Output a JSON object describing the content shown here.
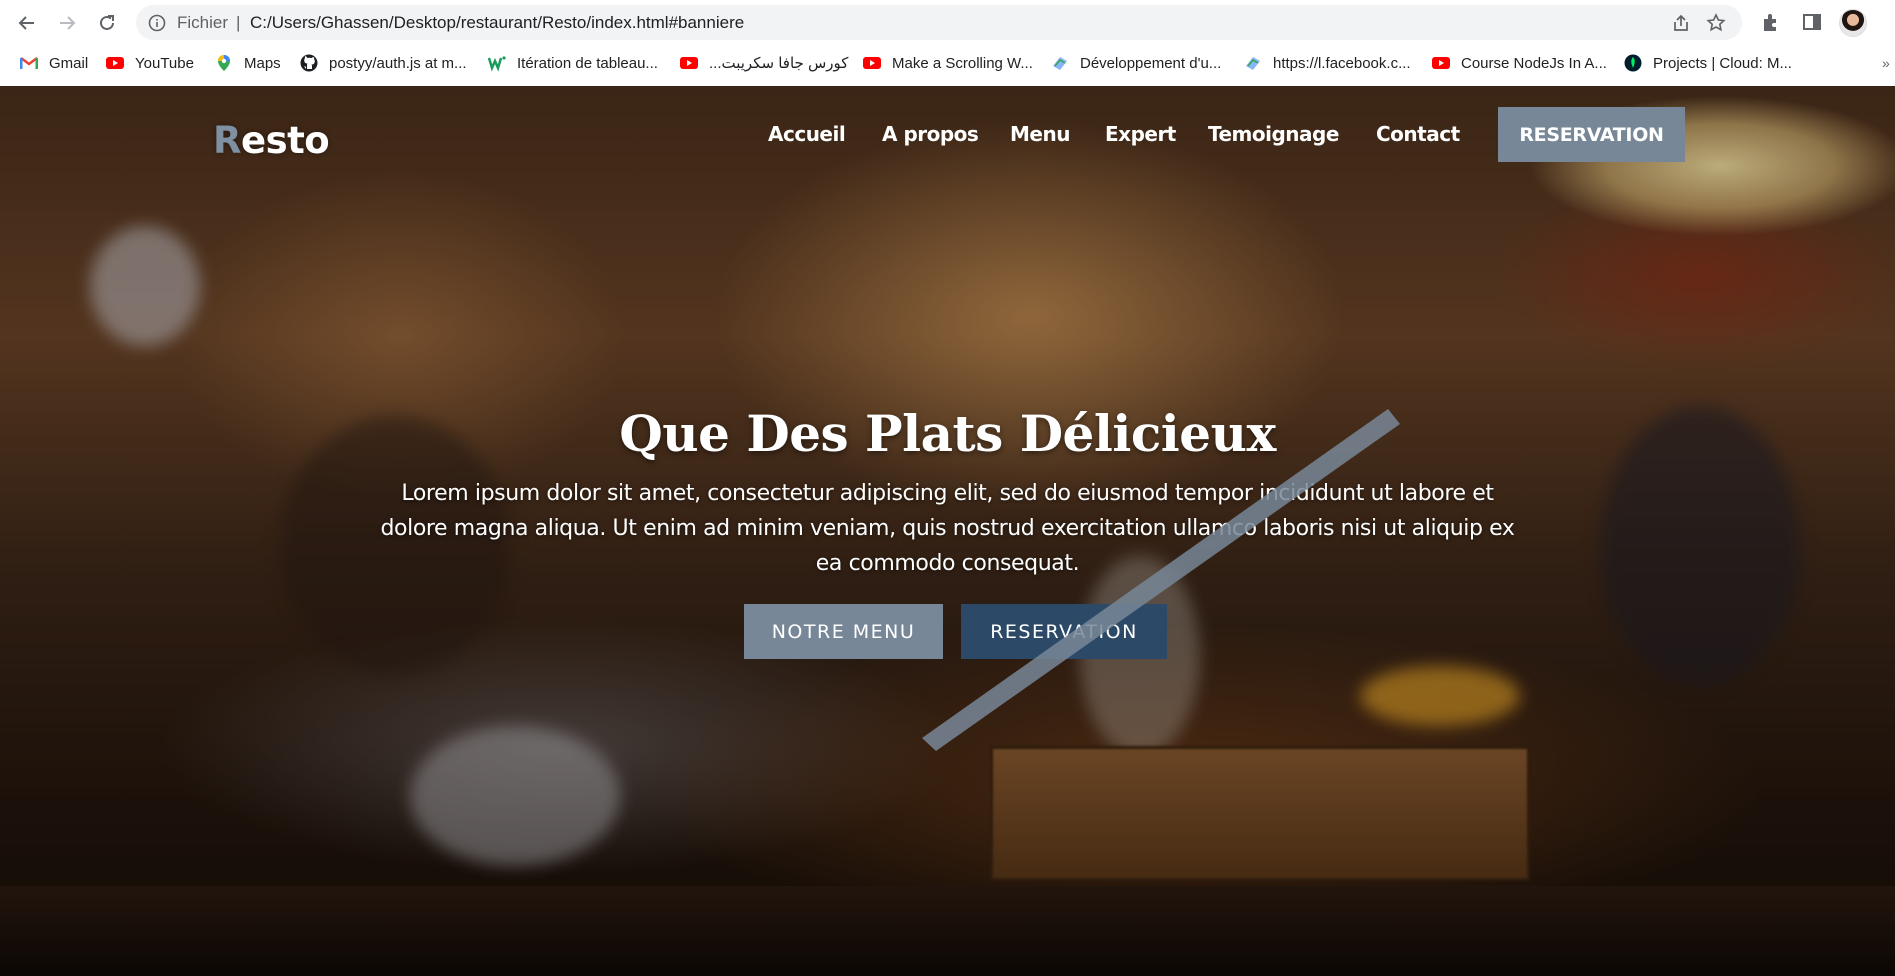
{
  "browser": {
    "scheme_label": "Fichier",
    "url": "C:/Users/Ghassen/Desktop/restaurant/Resto/index.html#banniere",
    "bookmarks": [
      {
        "label": "Gmail",
        "icon": "gmail-icon"
      },
      {
        "label": "YouTube",
        "icon": "youtube-icon"
      },
      {
        "label": "Maps",
        "icon": "maps-icon"
      },
      {
        "label": "postyy/auth.js at m...",
        "icon": "github-icon"
      },
      {
        "label": "Itération de tableau...",
        "icon": "w-icon"
      },
      {
        "label": "كورس جافا سكريبت...",
        "icon": "youtube-icon"
      },
      {
        "label": "Make a Scrolling W...",
        "icon": "youtube-icon"
      },
      {
        "label": "Développement d'u...",
        "icon": "bookmark-page-icon"
      },
      {
        "label": "https://l.facebook.c...",
        "icon": "bookmark-page-icon"
      },
      {
        "label": "Course NodeJs In A...",
        "icon": "youtube-icon"
      },
      {
        "label": "Projects | Cloud: M...",
        "icon": "mongodb-icon"
      }
    ]
  },
  "site": {
    "logo_first": "R",
    "logo_rest": "esto",
    "nav": [
      "Accueil",
      "A propos",
      "Menu",
      "Expert",
      "Temoignage",
      "Contact"
    ],
    "nav_cta": "RESERVATION",
    "hero_title": "Que Des Plats Délicieux",
    "hero_text": "Lorem ipsum dolor sit amet, consectetur adipiscing elit, sed do eiusmod tempor incididunt ut labore et dolore magna aliqua. Ut enim ad minim veniam, quis nostrud exercitation ullamco laboris nisi ut aliquip ex ea commodo consequat.",
    "btn_menu": "NOTRE MENU",
    "btn_reservation": "RESERVATION"
  },
  "colors": {
    "accent": "#778797",
    "button_dark": "#2c4a68"
  }
}
